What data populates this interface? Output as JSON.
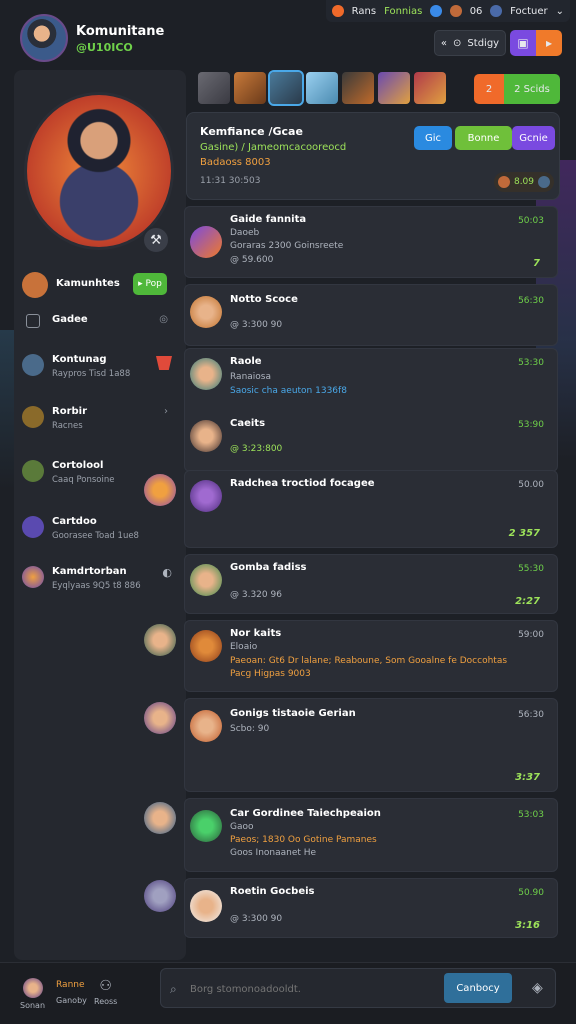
{
  "header": {
    "title": "Komunitane",
    "subtitle": "@U10ICO",
    "topbar": [
      "Rans",
      "Fonnias",
      "06",
      "Foctuer"
    ],
    "back_button": "Stdigy"
  },
  "games_strip": {
    "count": 7,
    "badge_left": "2",
    "badge_right": "2 Scids"
  },
  "feature": {
    "title": "Kemfiance /Gcae",
    "line1": "Gasine) / Jameomcacooreocd",
    "line2": "Badaoss 8003",
    "meta": "11:31 30:503",
    "buttons": [
      "Gic",
      "Bonne",
      "Gcnie"
    ],
    "badge": "8.09"
  },
  "sidebar": {
    "user": {
      "name": "Kamunhtes",
      "button": "Pop"
    },
    "items": [
      {
        "label": "Gadee",
        "sub": ""
      },
      {
        "label": "Kontunag",
        "sub": "Raypros Tisd 1a88"
      },
      {
        "label": "Rorbir",
        "sub": "Racnes"
      },
      {
        "label": "Cortolool",
        "sub": "Caaq Ponsoine"
      },
      {
        "label": "Cartdoo",
        "sub": "Goorasee Toad 1ue8"
      },
      {
        "label": "Kamdrtorban",
        "sub": "Eyqlyaas 9Q5 t8 886"
      }
    ]
  },
  "messages": [
    {
      "name": "Gaide fannita",
      "lines": [
        "Daoeb",
        "Goraras 2300 Goinsreete",
        "@ 59.600"
      ],
      "time": "50:03",
      "count": "7"
    },
    {
      "name": "Notto Scoce",
      "lines": [
        "@ 3:300 90"
      ],
      "time": "56:30",
      "count": ""
    },
    {
      "name": "Raole",
      "lines": [
        "Ranaiosa",
        "Saosic cha aeuton 1336f8"
      ],
      "time": "53:30",
      "count": ""
    },
    {
      "name": "Caeits",
      "lines": [
        "@ 3:23:800"
      ],
      "time": "53:90",
      "count": ""
    },
    {
      "name": "Radchea troctiod focagee",
      "lines": [],
      "time": "50.00",
      "count": "2 357"
    },
    {
      "name": "Gomba fadiss",
      "lines": [
        "@ 3.320 96"
      ],
      "time": "55:30",
      "count": "2:27"
    },
    {
      "name": "Nor kaits",
      "lines": [
        "Eloaio",
        "Paeoan: Gt6 Dr lalane; Reaboune, Som Gooalne fe Doccohtas",
        "Pacg Higpas 9003"
      ],
      "time": "59:00",
      "count": ""
    },
    {
      "name": "Gonigs tistaoie Gerian",
      "lines": [
        "Scbo: 90"
      ],
      "time": "56:30",
      "count": "3:37"
    },
    {
      "name": "Car Gordinee Taiechpeaion",
      "lines": [
        "Gaoo",
        "Paeos; 1830 Oo Gotine Pamanes",
        "Goos Inonaanet He"
      ],
      "time": "53:03",
      "count": ""
    },
    {
      "name": "Roetin Gocbeis",
      "lines": [
        "@ 3:300 90"
      ],
      "time": "50.90",
      "count": "3:16"
    }
  ],
  "composer": {
    "placeholder": "Borg stomonoadooldt.",
    "send_label": "Canbocy"
  },
  "bottom_nav": [
    {
      "label": "Ranne",
      "sub": "Sonan"
    },
    {
      "label": "Ganoby",
      "sub": ""
    },
    {
      "label": "Reoss",
      "sub": ""
    }
  ],
  "colors": {
    "accent_green": "#6fd04a",
    "accent_orange": "#f0a040",
    "accent_blue": "#4aa8e8",
    "panel": "#25282f"
  }
}
